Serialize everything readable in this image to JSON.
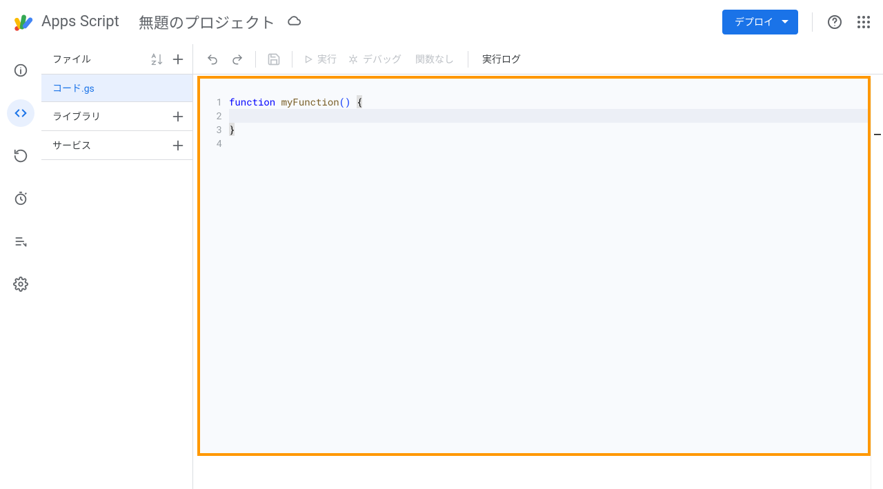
{
  "header": {
    "product_name": "Apps Script",
    "project_name": "無題のプロジェクト",
    "deploy_label": "デプロイ"
  },
  "sidepanel": {
    "files_heading": "ファイル",
    "file_name": "コード.gs",
    "section_libraries": "ライブラリ",
    "section_services": "サービス"
  },
  "toolbar": {
    "run_label": "実行",
    "debug_label": "デバッグ",
    "func_label": "関数なし",
    "exec_log_label": "実行ログ"
  },
  "code": {
    "gutter": [
      "1",
      "2",
      "3",
      "4"
    ],
    "line1_kw": "function",
    "line1_sp1": " ",
    "line1_fn": "myFunction",
    "line1_paren": "()",
    "line1_sp2": " ",
    "line1_brace_open": "{",
    "line2": "  ",
    "line3_brace_close": "}",
    "line4": ""
  }
}
